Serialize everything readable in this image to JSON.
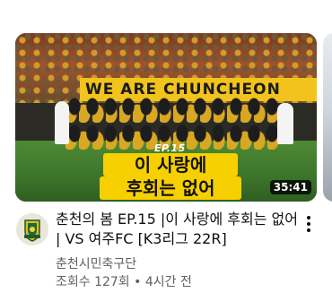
{
  "video": {
    "thumbnail": {
      "banner_text": "WE ARE CHUNCHEON",
      "episode_tag": "EP.15",
      "caption_line1": "이 사랑에",
      "caption_line2": "후회는 없어",
      "duration": "35:41"
    },
    "title": "춘천의 봄 EP.15 |이 사랑에 후회는 없어 | VS 여주FC [K3리그 22R]",
    "channel": "춘천시민축구단",
    "views": "조회수 127회",
    "separator": "•",
    "uploaded": "4시간 전"
  },
  "icons": {
    "more": "more-vert-icon",
    "avatar": "club-crest-icon"
  },
  "colors": {
    "title": "#0f0f0f",
    "secondary": "#606060",
    "caption_bg": "#f6d000",
    "banner_bg": "#f2c31d"
  }
}
